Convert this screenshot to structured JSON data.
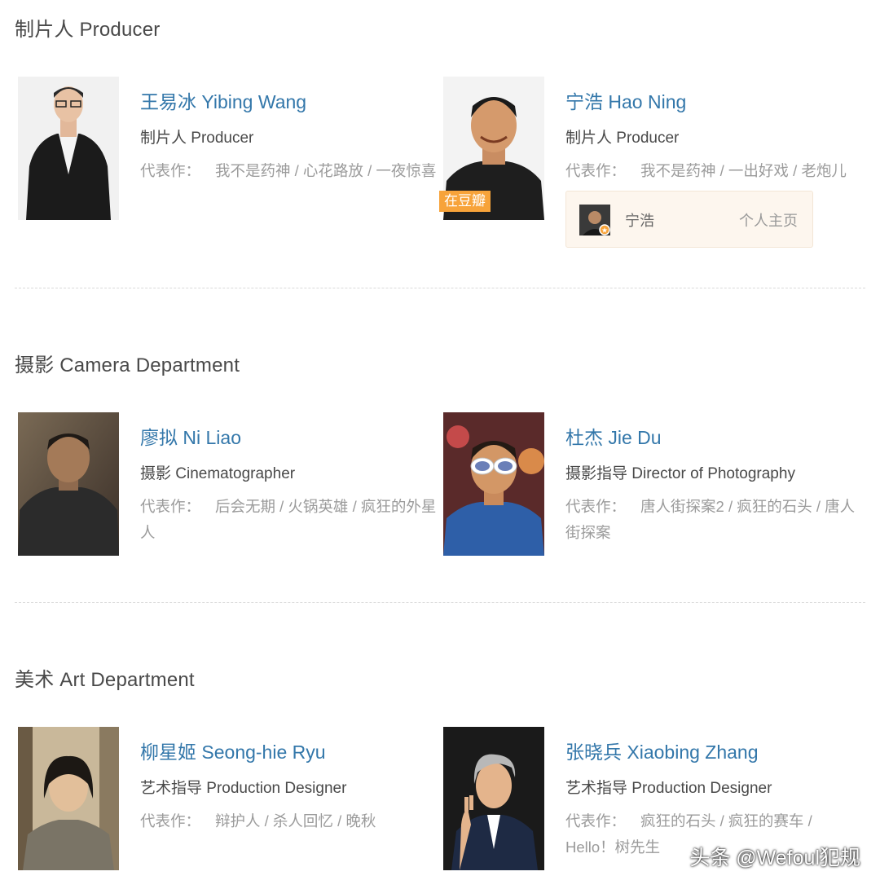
{
  "sections": [
    {
      "title": "制片人 Producer",
      "people": [
        {
          "name": "王易冰 Yibing Wang",
          "role": "制片人 Producer",
          "works_label": "代表作：",
          "works": "我不是药神 / 心花路放 / 一夜惊喜"
        },
        {
          "name": "宁浩 Hao Ning",
          "role": "制片人 Producer",
          "works_label": "代表作：",
          "works": "我不是药神 / 一出好戏 / 老炮儿",
          "badge": "在豆瓣",
          "profile": {
            "name": "宁浩",
            "link": "个人主页"
          }
        }
      ]
    },
    {
      "title": "摄影 Camera Department",
      "people": [
        {
          "name": "廖拟 Ni Liao",
          "role": "摄影 Cinematographer",
          "works_label": "代表作：",
          "works": "后会无期 / 火锅英雄 / 疯狂的外星人"
        },
        {
          "name": "杜杰 Jie Du",
          "role": "摄影指导 Director of Photography",
          "works_label": "代表作：",
          "works": "唐人街探案2 / 疯狂的石头 / 唐人街探案"
        }
      ]
    },
    {
      "title": "美术 Art Department",
      "people": [
        {
          "name": "柳星姬 Seong-hie Ryu",
          "role": "艺术指导 Production Designer",
          "works_label": "代表作：",
          "works": "辩护人 / 杀人回忆 / 晚秋"
        },
        {
          "name": "张晓兵 Xiaobing Zhang",
          "role": "艺术指导 Production Designer",
          "works_label": "代表作：",
          "works": "疯狂的石头 / 疯狂的赛车 / Hello！树先生"
        }
      ]
    }
  ],
  "watermark": "头条 @Wefoul犯规",
  "colors": {
    "name_link": "#3377aa",
    "badge": "#f7a33a",
    "muted": "#9b9b9b"
  }
}
